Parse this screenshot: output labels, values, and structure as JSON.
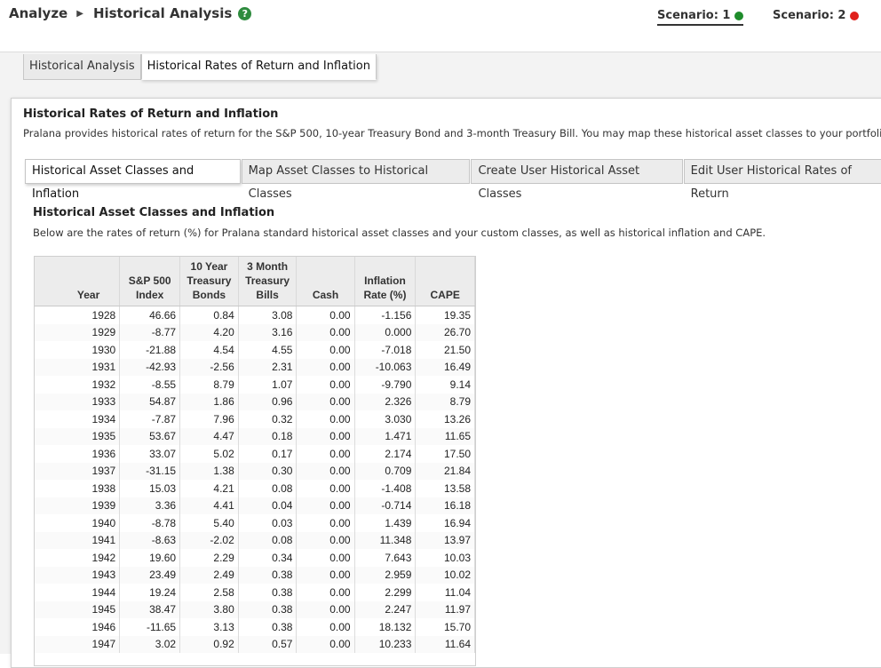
{
  "header": {
    "breadcrumb_root": "Analyze",
    "breadcrumb_page": "Historical Analysis",
    "help_glyph": "?",
    "scenario1_label": "Scenario: 1",
    "scenario2_label": "Scenario: 2",
    "scenario1_color": "#1e8c2b",
    "scenario2_color": "#e0201b"
  },
  "outer_tabs": [
    "Historical Analysis",
    "Historical Rates of Return and Inflation"
  ],
  "panel": {
    "title": "Historical Rates of Return and Inflation",
    "description": "Pralana provides historical rates of return for the S&P 500, 10-year Treasury Bond and 3-month Treasury Bill. You may map these historical asset classes to your portfolio a"
  },
  "inner_tabs": [
    "Historical Asset Classes and Inflation",
    "Map Asset Classes to Historical Classes",
    "Create User Historical Asset Classes",
    "Edit User Historical Rates of Return"
  ],
  "section": {
    "title": "Historical Asset Classes and Inflation",
    "description": "Below are the rates of return (%) for Pralana standard historical asset classes and your custom classes, as well as historical inflation and CAPE."
  },
  "table": {
    "columns": [
      [
        "Year"
      ],
      [
        "S&P 500",
        "Index"
      ],
      [
        "10 Year",
        "Treasury",
        "Bonds"
      ],
      [
        "3 Month",
        "Treasury",
        "Bills"
      ],
      [
        "Cash"
      ],
      [
        "Inflation",
        "Rate (%)"
      ],
      [
        "CAPE"
      ]
    ],
    "rows": [
      [
        "1928",
        "46.66",
        "0.84",
        "3.08",
        "0.00",
        "-1.156",
        "19.35"
      ],
      [
        "1929",
        "-8.77",
        "4.20",
        "3.16",
        "0.00",
        "0.000",
        "26.70"
      ],
      [
        "1930",
        "-21.88",
        "4.54",
        "4.55",
        "0.00",
        "-7.018",
        "21.50"
      ],
      [
        "1931",
        "-42.93",
        "-2.56",
        "2.31",
        "0.00",
        "-10.063",
        "16.49"
      ],
      [
        "1932",
        "-8.55",
        "8.79",
        "1.07",
        "0.00",
        "-9.790",
        "9.14"
      ],
      [
        "1933",
        "54.87",
        "1.86",
        "0.96",
        "0.00",
        "2.326",
        "8.79"
      ],
      [
        "1934",
        "-7.87",
        "7.96",
        "0.32",
        "0.00",
        "3.030",
        "13.26"
      ],
      [
        "1935",
        "53.67",
        "4.47",
        "0.18",
        "0.00",
        "1.471",
        "11.65"
      ],
      [
        "1936",
        "33.07",
        "5.02",
        "0.17",
        "0.00",
        "2.174",
        "17.50"
      ],
      [
        "1937",
        "-31.15",
        "1.38",
        "0.30",
        "0.00",
        "0.709",
        "21.84"
      ],
      [
        "1938",
        "15.03",
        "4.21",
        "0.08",
        "0.00",
        "-1.408",
        "13.58"
      ],
      [
        "1939",
        "3.36",
        "4.41",
        "0.04",
        "0.00",
        "-0.714",
        "16.18"
      ],
      [
        "1940",
        "-8.78",
        "5.40",
        "0.03",
        "0.00",
        "1.439",
        "16.94"
      ],
      [
        "1941",
        "-8.63",
        "-2.02",
        "0.08",
        "0.00",
        "11.348",
        "13.97"
      ],
      [
        "1942",
        "19.60",
        "2.29",
        "0.34",
        "0.00",
        "7.643",
        "10.03"
      ],
      [
        "1943",
        "23.49",
        "2.49",
        "0.38",
        "0.00",
        "2.959",
        "10.02"
      ],
      [
        "1944",
        "19.24",
        "2.58",
        "0.38",
        "0.00",
        "2.299",
        "11.04"
      ],
      [
        "1945",
        "38.47",
        "3.80",
        "0.38",
        "0.00",
        "2.247",
        "11.97"
      ],
      [
        "1946",
        "-11.65",
        "3.13",
        "0.38",
        "0.00",
        "18.132",
        "15.70"
      ],
      [
        "1947",
        "3.02",
        "0.92",
        "0.57",
        "0.00",
        "10.233",
        "11.64"
      ]
    ]
  }
}
